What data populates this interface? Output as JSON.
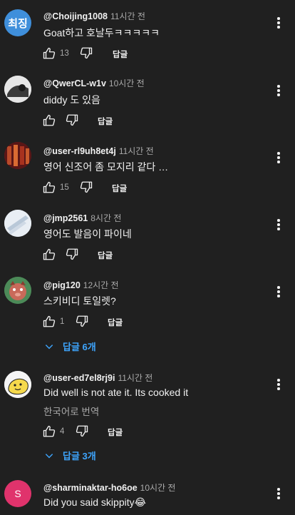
{
  "colors": {
    "background": "#202020",
    "text": "#f1f1f1",
    "muted": "#aaaaaa",
    "link": "#3ea6ff"
  },
  "comments": [
    {
      "avatar_text": "최징",
      "avatar_color": "#3f8fdb",
      "handle": "@Choijing1008",
      "time": "11시간 전",
      "text": "Goat하고 호날두ㅋㅋㅋㅋㅋ",
      "likes": "13",
      "reply_label": "답글"
    },
    {
      "avatar_icon": "photo-avatar",
      "avatar_color": "#d8d8d8",
      "handle": "@QwerCL-w1v",
      "time": "10시간 전",
      "text": "diddy 도 있음",
      "likes": "",
      "reply_label": "답글"
    },
    {
      "avatar_icon": "photo-avatar",
      "avatar_color": "#7a2020",
      "handle": "@user-rl9uh8et4j",
      "time": "11시간 전",
      "text": "영어 신조어 좀 모지리 같다 …",
      "likes": "15",
      "reply_label": "답글"
    },
    {
      "avatar_icon": "photo-avatar",
      "avatar_color": "#dfe6ef",
      "handle": "@jmp2561",
      "time": "8시간 전",
      "text": "영어도 발음이 파이네",
      "likes": "",
      "reply_label": "답글"
    },
    {
      "avatar_icon": "photo-avatar",
      "avatar_color": "#3e7a4a",
      "handle": "@pig120",
      "time": "12시간 전",
      "text": "스키비디 토일렛?",
      "likes": "1",
      "reply_label": "답글",
      "replies_label": "답글 6개"
    },
    {
      "avatar_icon": "photo-avatar",
      "avatar_color": "#f7f7f7",
      "handle": "@user-ed7el8rj9i",
      "time": "11시간 전",
      "text": "Did well is not ate it. Its cooked it",
      "translate_label": "한국어로 번역",
      "likes": "4",
      "reply_label": "답글",
      "replies_label": "답글 3개"
    },
    {
      "avatar_text": "S",
      "avatar_color": "#e0336c",
      "handle": "@sharminaktar-ho6oe",
      "time": "10시간 전",
      "text": "Did you said skippity😂"
    }
  ]
}
